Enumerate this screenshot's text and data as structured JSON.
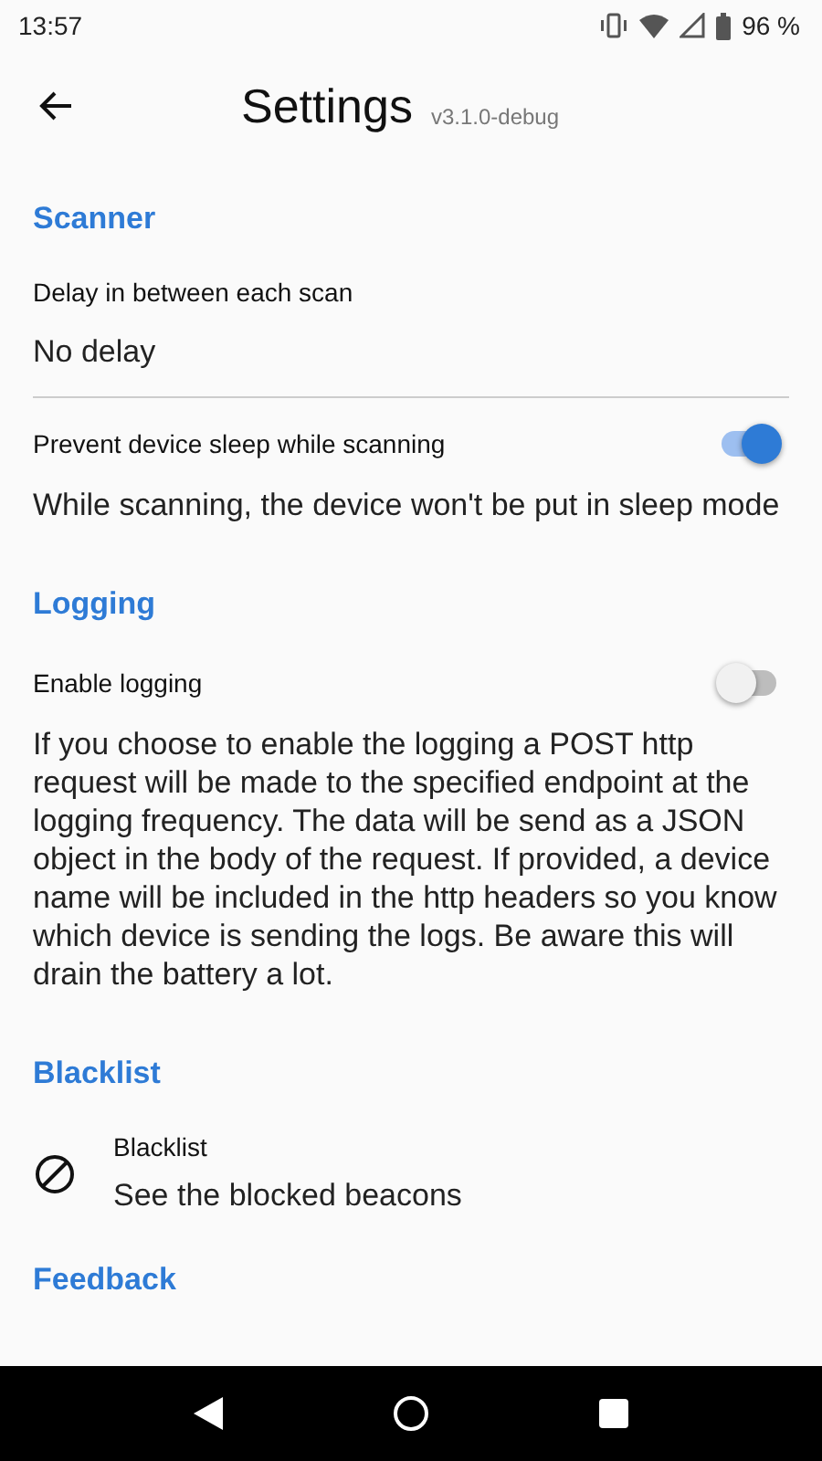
{
  "status_bar": {
    "time": "13:57",
    "battery": "96 %"
  },
  "toolbar": {
    "title": "Settings",
    "version": "v3.1.0-debug"
  },
  "sections": [
    {
      "title": "Scanner",
      "items": [
        {
          "kind": "value",
          "title": "Delay in between each scan",
          "value": "No delay"
        },
        {
          "kind": "switch",
          "title": "Prevent device sleep while scanning",
          "on": true,
          "description": "While scanning, the device won't be put in sleep mode"
        }
      ]
    },
    {
      "title": "Logging",
      "items": [
        {
          "kind": "switch",
          "title": "Enable logging",
          "on": false,
          "description": "If you choose to enable the logging a POST http request will be made to the specified endpoint at the logging frequency. The data will be send as a JSON object in the body of the request. If provided, a device name will be included in the http headers so you know which device is sending the logs. Be aware this will drain the battery a lot."
        }
      ]
    },
    {
      "title": "Blacklist",
      "items": [
        {
          "kind": "link",
          "title": "Blacklist",
          "value": "See the blocked beacons"
        }
      ]
    },
    {
      "title": "Feedback"
    }
  ]
}
